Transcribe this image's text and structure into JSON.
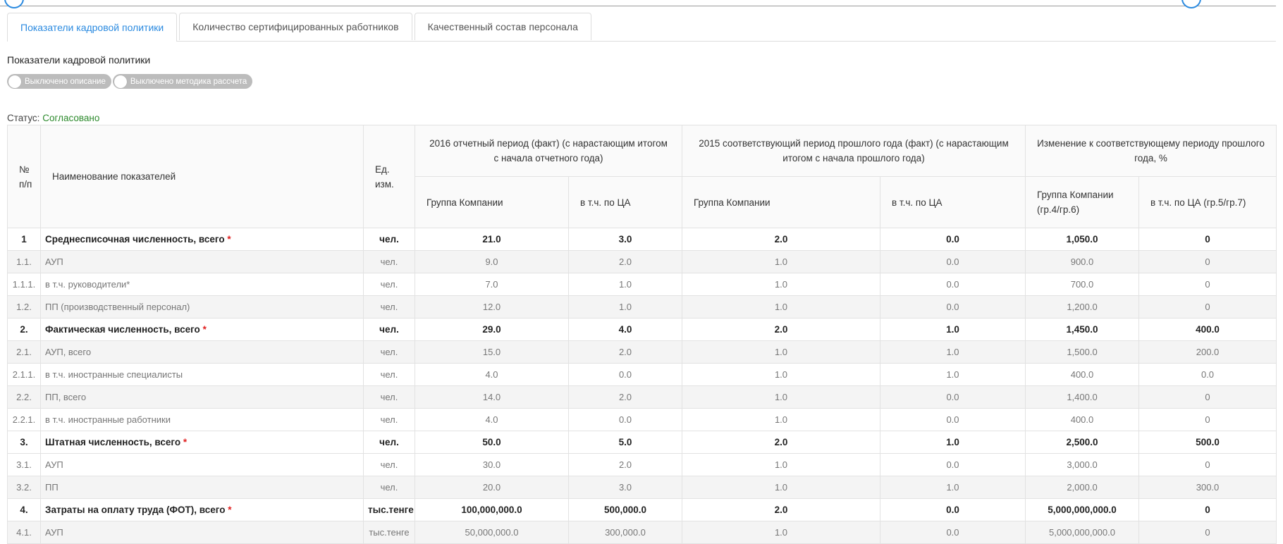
{
  "tabs": [
    {
      "label": "Показатели кадровой политики"
    },
    {
      "label": "Количество сертифицированных работников"
    },
    {
      "label": "Качественный состав персонала"
    }
  ],
  "section_title": "Показатели кадровой политики",
  "toggles": {
    "description": "Выключено описание",
    "methodology": "Выключено методика рассчета"
  },
  "status": {
    "label": "Статус:",
    "value": "Согласовано"
  },
  "table": {
    "headers": {
      "no": "№ п/п",
      "name": "Наименование показателей",
      "unit": "Ед. изм.",
      "period_current": "2016 отчетный период (факт) (с нарастающим итогом с начала отчетного года)",
      "period_previous": "2015 соответствующий период прошлого года (факт) (с нарастающим итогом с начала прошлого года)",
      "change": "Изменение к соответствующему периоду прошлого года, %",
      "group_company": "Группа Компании",
      "incl_ca": "в т.ч. по ЦА",
      "group_company_ratio": "Группа Компании (гр.4/гр.6)",
      "incl_ca_ratio": "в т.ч. по ЦА (гр.5/гр.7)"
    },
    "rows": [
      {
        "no": "1",
        "name": "Среднесписочная численность, всего",
        "required": "*",
        "bold": true,
        "unit": "чел.",
        "cur_group": "21.0",
        "cur_ca": "3.0",
        "prev_group": "2.0",
        "prev_ca": "0.0",
        "chg_group": "1,050.0",
        "chg_ca": "0"
      },
      {
        "no": "1.1.",
        "name": "АУП",
        "required": "",
        "bold": false,
        "unit": "чел.",
        "cur_group": "9.0",
        "cur_ca": "2.0",
        "prev_group": "1.0",
        "prev_ca": "0.0",
        "chg_group": "900.0",
        "chg_ca": "0"
      },
      {
        "no": "1.1.1.",
        "name": "в т.ч. руководители*",
        "required": "",
        "bold": false,
        "unit": "чел.",
        "cur_group": "7.0",
        "cur_ca": "1.0",
        "prev_group": "1.0",
        "prev_ca": "0.0",
        "chg_group": "700.0",
        "chg_ca": "0"
      },
      {
        "no": "1.2.",
        "name": "ПП (производственный персонал)",
        "required": "",
        "bold": false,
        "unit": "чел.",
        "cur_group": "12.0",
        "cur_ca": "1.0",
        "prev_group": "1.0",
        "prev_ca": "0.0",
        "chg_group": "1,200.0",
        "chg_ca": "0"
      },
      {
        "no": "2.",
        "name": "Фактическая численность, всего",
        "required": "*",
        "bold": true,
        "unit": "чел.",
        "cur_group": "29.0",
        "cur_ca": "4.0",
        "prev_group": "2.0",
        "prev_ca": "1.0",
        "chg_group": "1,450.0",
        "chg_ca": "400.0"
      },
      {
        "no": "2.1.",
        "name": "АУП, всего",
        "required": "",
        "bold": false,
        "unit": "чел.",
        "cur_group": "15.0",
        "cur_ca": "2.0",
        "prev_group": "1.0",
        "prev_ca": "1.0",
        "chg_group": "1,500.0",
        "chg_ca": "200.0"
      },
      {
        "no": "2.1.1.",
        "name": "в т.ч. иностранные специалисты",
        "required": "",
        "bold": false,
        "unit": "чел.",
        "cur_group": "4.0",
        "cur_ca": "0.0",
        "prev_group": "1.0",
        "prev_ca": "1.0",
        "chg_group": "400.0",
        "chg_ca": "0.0"
      },
      {
        "no": "2.2.",
        "name": "ПП, всего",
        "required": "",
        "bold": false,
        "unit": "чел.",
        "cur_group": "14.0",
        "cur_ca": "2.0",
        "prev_group": "1.0",
        "prev_ca": "0.0",
        "chg_group": "1,400.0",
        "chg_ca": "0"
      },
      {
        "no": "2.2.1.",
        "name": "в т.ч. иностранные работники",
        "required": "",
        "bold": false,
        "unit": "чел.",
        "cur_group": "4.0",
        "cur_ca": "0.0",
        "prev_group": "1.0",
        "prev_ca": "0.0",
        "chg_group": "400.0",
        "chg_ca": "0"
      },
      {
        "no": "3.",
        "name": "Штатная численность, всего",
        "required": "*",
        "bold": true,
        "unit": "чел.",
        "cur_group": "50.0",
        "cur_ca": "5.0",
        "prev_group": "2.0",
        "prev_ca": "1.0",
        "chg_group": "2,500.0",
        "chg_ca": "500.0"
      },
      {
        "no": "3.1.",
        "name": "АУП",
        "required": "",
        "bold": false,
        "unit": "чел.",
        "cur_group": "30.0",
        "cur_ca": "2.0",
        "prev_group": "1.0",
        "prev_ca": "0.0",
        "chg_group": "3,000.0",
        "chg_ca": "0"
      },
      {
        "no": "3.2.",
        "name": "ПП",
        "required": "",
        "bold": false,
        "unit": "чел.",
        "cur_group": "20.0",
        "cur_ca": "3.0",
        "prev_group": "1.0",
        "prev_ca": "1.0",
        "chg_group": "2,000.0",
        "chg_ca": "300.0"
      },
      {
        "no": "4.",
        "name": "Затраты на оплату труда (ФОТ), всего",
        "required": "*",
        "bold": true,
        "unit": "тыс.тенге",
        "cur_group": "100,000,000.0",
        "cur_ca": "500,000.0",
        "prev_group": "2.0",
        "prev_ca": "0.0",
        "chg_group": "5,000,000,000.0",
        "chg_ca": "0"
      },
      {
        "no": "4.1.",
        "name": "АУП",
        "required": "",
        "bold": false,
        "unit": "тыс.тенге",
        "cur_group": "50,000,000.0",
        "cur_ca": "300,000.0",
        "prev_group": "1.0",
        "prev_ca": "0.0",
        "chg_group": "5,000,000,000.0",
        "chg_ca": "0"
      }
    ]
  }
}
